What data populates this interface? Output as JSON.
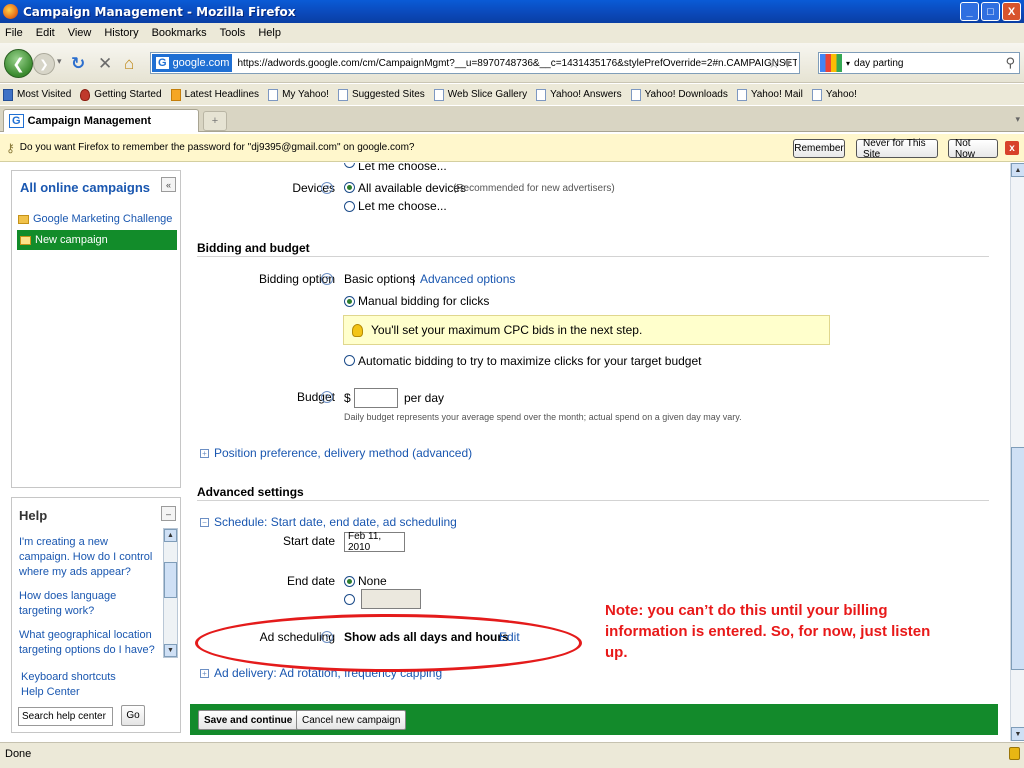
{
  "window": {
    "title": "Campaign Management - Mozilla Firefox",
    "controls": [
      "_",
      "□",
      "X"
    ]
  },
  "menu": [
    "File",
    "Edit",
    "View",
    "History",
    "Bookmarks",
    "Tools",
    "Help"
  ],
  "nav": {
    "site_badge": "google.com",
    "url": "https://adwords.google.com/cm/CampaignMgmt?__u=8970748736&__c=1431435176&stylePrefOverride=2#n.CAMPAIGNSETTINGS",
    "search_value": "day parting"
  },
  "bookmarks": [
    "Most Visited",
    "Getting Started",
    "Latest Headlines",
    "My Yahoo!",
    "Suggested Sites",
    "Web Slice Gallery",
    "Yahoo! Answers",
    "Yahoo! Downloads",
    "Yahoo! Mail",
    "Yahoo!"
  ],
  "tab": {
    "label": "Campaign Management",
    "favicon": "G",
    "new_tab": "+"
  },
  "password_bar": {
    "message": "Do you want Firefox to remember the password for \"dj9395@gmail.com\" on google.com?",
    "remember": "Remember",
    "never": "Never for This Site",
    "not_now": "Not Now"
  },
  "sidebar": {
    "campaigns_head": "All online campaigns",
    "collapse": "«",
    "campaigns": [
      "Google Marketing Challenge",
      "New campaign"
    ],
    "help_head": "Help",
    "help_collapse": "–",
    "help_links": [
      "I'm creating a new campaign. How do I control where my ads appear?",
      "How does language targeting work?",
      "What geographical location targeting options do I have?"
    ],
    "keyboard_shortcuts": "Keyboard shortcuts",
    "help_center": "Help Center",
    "search_help": "Search help center",
    "go": "Go"
  },
  "main": {
    "cut_top": "Let me choose...",
    "devices_label": "Devices",
    "devices_all": "All available devices",
    "devices_all_note": "(Recommended for new advertisers)",
    "devices_choose": "Let me choose...",
    "bidding_head": "Bidding and budget",
    "bidding_label": "Bidding option",
    "basic_options": "Basic options",
    "separator": "|",
    "advanced_options": "Advanced options",
    "manual_bidding": "Manual bidding for clicks",
    "tip": "You'll set your maximum CPC bids in the next step.",
    "automatic_bidding": "Automatic bidding to try to maximize clicks for your target budget",
    "budget_label": "Budget",
    "currency": "$",
    "per_day": "per day",
    "budget_note": "Daily budget represents your average spend over the month; actual spend on a given day may vary.",
    "position_pref": "Position preference, delivery method (advanced)",
    "advanced_head": "Advanced settings",
    "schedule": "Schedule: Start date, end date, ad scheduling",
    "start_label": "Start date",
    "start_value": "Feb 11, 2010",
    "end_label": "End date",
    "end_none": "None",
    "ad_sched_label": "Ad scheduling",
    "ad_sched_value": "Show ads all days and hours",
    "edit": "Edit",
    "ad_delivery": "Ad delivery: Ad rotation, frequency capping",
    "save_continue": "Save and continue",
    "cancel_new": "Cancel new campaign"
  },
  "annotation": {
    "note": "Note: you can’t do this until your billing information is entered. So, for now, just listen up.",
    "color": "#e41b1b"
  },
  "status": {
    "text": "Done"
  },
  "colors": {
    "accent_green": "#138a2b",
    "link_blue": "#1a57b0",
    "titlebar_blue": "#0b48b8"
  }
}
